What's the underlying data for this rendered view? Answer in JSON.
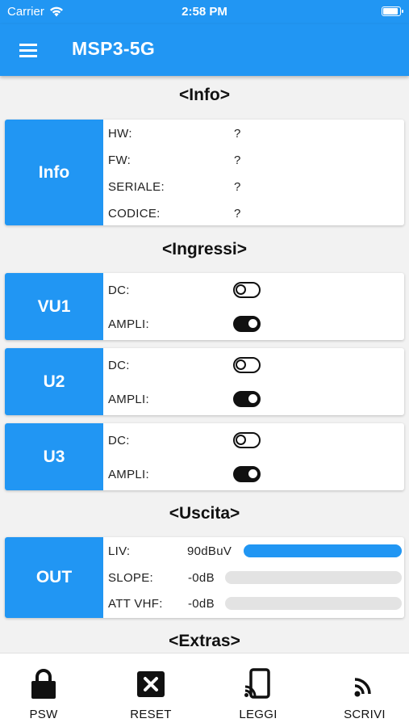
{
  "status_bar": {
    "carrier": "Carrier",
    "time": "2:58 PM"
  },
  "app_bar": {
    "title": "MSP3-5G"
  },
  "sections": {
    "info": "<Info>",
    "inputs": "<Ingressi>",
    "output": "<Uscita>",
    "extras": "<Extras>"
  },
  "info_card": {
    "tag": "Info",
    "rows": [
      {
        "label": "HW:",
        "value": "?"
      },
      {
        "label": "FW:",
        "value": "?"
      },
      {
        "label": "SERIALE:",
        "value": "?"
      },
      {
        "label": "CODICE:",
        "value": "?"
      }
    ]
  },
  "inputs": [
    {
      "tag": "VU1",
      "dc_label": "DC:",
      "dc_on": false,
      "ampli_label": "AMPLI:",
      "ampli_on": true
    },
    {
      "tag": "U2",
      "dc_label": "DC:",
      "dc_on": false,
      "ampli_label": "AMPLI:",
      "ampli_on": true
    },
    {
      "tag": "U3",
      "dc_label": "DC:",
      "dc_on": false,
      "ampli_label": "AMPLI:",
      "ampli_on": true
    }
  ],
  "output_card": {
    "tag": "OUT",
    "rows": [
      {
        "label": "LIV:",
        "value": "90dBuV",
        "level": 1.0
      },
      {
        "label": "SLOPE:",
        "value": "-0dB",
        "level": 0.0
      },
      {
        "label": "ATT VHF:",
        "value": "-0dB",
        "level": 0.0
      }
    ]
  },
  "bottom_nav": [
    {
      "label": "PSW",
      "icon": "lock-icon"
    },
    {
      "label": "RESET",
      "icon": "close-box-icon"
    },
    {
      "label": "LEGGI",
      "icon": "phone-cast-icon"
    },
    {
      "label": "SCRIVI",
      "icon": "cast-signal-icon"
    }
  ],
  "colors": {
    "primary": "#2196f3",
    "toggle": "#111111",
    "track": "#e3e3e3"
  }
}
